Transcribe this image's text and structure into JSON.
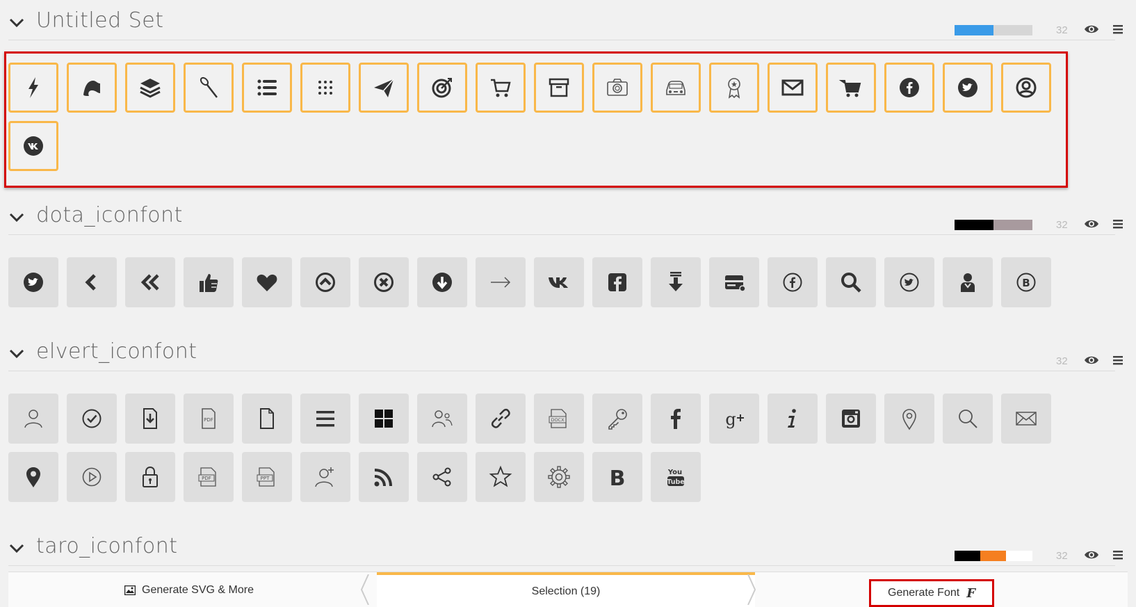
{
  "sets": [
    {
      "title": "Untitled Set",
      "size": "32",
      "colors": [
        "#3a9be8",
        "#d6d6d6"
      ],
      "color_widths": [
        0.5,
        0.5
      ],
      "selected": true,
      "icons": [
        "lightning-icon",
        "flag-icon",
        "layers-icon",
        "toothbrush-icon",
        "list-icon",
        "grid-dots-icon",
        "paper-plane-icon",
        "target-icon",
        "cart-outline-icon",
        "archive-icon",
        "camera-icon",
        "car-icon",
        "award-icon",
        "mail-icon",
        "shopping-cart-icon",
        "facebook-circle-icon",
        "twitter-circle-icon",
        "user-circle-icon",
        "vk-circle-icon"
      ]
    },
    {
      "title": "dota_iconfont",
      "size": "32",
      "colors": [
        "#000000",
        "#a89a9e"
      ],
      "color_widths": [
        0.5,
        0.5
      ],
      "selected": false,
      "icons": [
        "twitter-circle-icon",
        "chevron-left-icon",
        "double-chevron-left-icon",
        "thumbs-up-icon",
        "heart-icon",
        "arrow-up-circle-icon",
        "close-circle-icon",
        "arrow-down-circle-icon",
        "arrow-right-icon",
        "vk-icon",
        "facebook-square-icon",
        "download-arrow-icon",
        "card-icon",
        "facebook-outline-circle-icon",
        "search-icon",
        "twitter-outline-circle-icon",
        "user-icon",
        "b-circle-icon"
      ]
    },
    {
      "title": "elvert_iconfont",
      "size": "32",
      "colors": [],
      "color_widths": [],
      "selected": false,
      "icons": [
        "user-outline-icon",
        "check-circle-icon",
        "file-download-icon",
        "pdf-file-icon",
        "file-icon",
        "hamburger-icon",
        "grid-icon",
        "users-icon",
        "link-icon",
        "docx-file-icon",
        "key-icon",
        "facebook-f-icon",
        "google-plus-icon",
        "info-icon",
        "instagram-icon",
        "map-pin-outline-icon",
        "search-outline-icon",
        "envelope-outline-icon",
        "map-pin-icon",
        "play-circle-icon",
        "lock-icon",
        "pdf-outline-icon",
        "ppt-file-icon",
        "add-user-icon",
        "rss-icon",
        "share-icon",
        "star-outline-icon",
        "gear-icon",
        "bold-b-icon",
        "youtube-icon"
      ]
    },
    {
      "title": "taro_iconfont",
      "size": "32",
      "colors": [
        "#000000",
        "#f57f20",
        "#ffffff"
      ],
      "color_widths": [
        0.33,
        0.33,
        0.34
      ],
      "selected": false,
      "icons": []
    }
  ],
  "bottom_bar": {
    "generate_svg_label": "Generate SVG & More",
    "selection_label": "Selection (19)",
    "generate_font_label": "Generate Font",
    "font_glyph": "F"
  }
}
